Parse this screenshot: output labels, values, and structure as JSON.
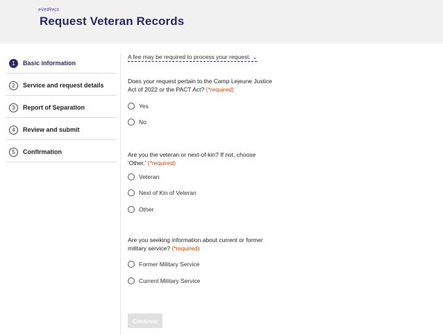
{
  "header": {
    "brand": "eVetRecs",
    "title": "Request Veteran Records"
  },
  "steps": [
    {
      "number": "1",
      "label": "Basic information",
      "active": true
    },
    {
      "number": "2",
      "label": "Service and request details",
      "active": false
    },
    {
      "number": "3",
      "label": "Report of Separation",
      "active": false
    },
    {
      "number": "4",
      "label": "Review and submit",
      "active": false
    },
    {
      "number": "5",
      "label": "Confirmation",
      "active": false
    }
  ],
  "fee_notice": "A fee may be required to process your request.",
  "required_marker": "(*required)",
  "q1": {
    "text": "Does your request pertain to the Camp Lejeune Justice Act of 2022 or the PACT Act?",
    "options": [
      "Yes",
      "No"
    ]
  },
  "q2": {
    "text": "Are you the veteran or next-of-kin? If not, choose 'Other.'",
    "options": [
      "Veteran",
      "Next of Kin of Veteran",
      "Other"
    ]
  },
  "q3": {
    "text": "Are you seeking information about current or former military service?",
    "options": [
      "Former Military Service",
      "Current Military Service"
    ]
  },
  "continue_label": "Continue"
}
